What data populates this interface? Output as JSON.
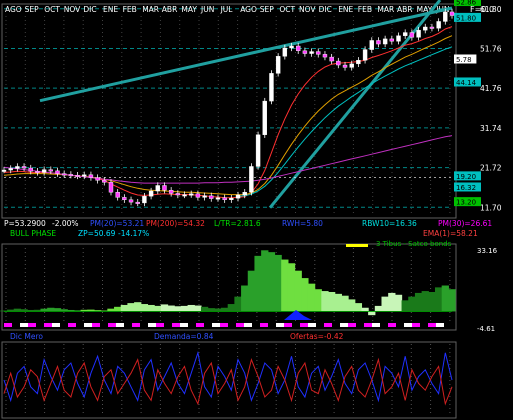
{
  "header": {
    "months": [
      "AGO",
      "SEP",
      "OCT",
      "NOV",
      "DIC",
      "ENE",
      "FEB",
      "MAR",
      "ABR",
      "MAY",
      "JUN",
      "JUL",
      "AGO",
      "SEP",
      "OCT",
      "NOV",
      "DIC",
      "ENE",
      "FEB",
      "MAR",
      "ABR",
      "MAY",
      "JUN"
    ],
    "f_label": "F=0.0"
  },
  "price_panel": {
    "axis_labels": [
      "61.80",
      "51.76",
      "41.76",
      "31.74",
      "21.72",
      "11.70"
    ],
    "level_tags": [
      {
        "text": "52.86",
        "color": "#00c000"
      },
      {
        "text": "51.80",
        "color": "#00c0c0"
      },
      {
        "text": "5.78",
        "color": "#ffffff"
      },
      {
        "text": "44.14",
        "color": "#00c0c0"
      },
      {
        "text": "19.20",
        "color": "#00c0c0"
      },
      {
        "text": "16.32",
        "color": "#00c0c0"
      },
      {
        "text": "13.20",
        "color": "#00c000"
      }
    ],
    "indicators_row1": [
      {
        "text": "P=53.2900",
        "color": "#ffffff"
      },
      {
        "text": "-2.00%",
        "color": "#ffffff"
      },
      {
        "text": "PM(20)=53.21",
        "color": "#3050ff"
      },
      {
        "text": "PM(200)=54.32",
        "color": "#ff3030"
      },
      {
        "text": "L/TR=2.81.6",
        "color": "#00e000"
      },
      {
        "text": "RWH=5.80",
        "color": "#3050ff"
      },
      {
        "text": "RBW10=16.36",
        "color": "#00e0e0"
      },
      {
        "text": "PM(30)=26.61",
        "color": "#ff00ff"
      }
    ],
    "indicators_row2": [
      {
        "text": "BULL PHASE",
        "color": "#00e000"
      },
      {
        "text": "ZP=50.69",
        "color": "#00e0ff"
      },
      {
        "text": "-14.17%",
        "color": "#00e0ff"
      },
      {
        "text": "EMA(1)=58.21",
        "color": "#ff4040"
      }
    ]
  },
  "oscillator_panel": {
    "title": "3 Tibus - Satco bonds",
    "max_label": "33.16",
    "min_label": "-4.61"
  },
  "bottom_panel": {
    "labels": [
      {
        "text": "Dic Mero",
        "color": "#3050ff"
      },
      {
        "text": "Demanda=0.84",
        "color": "#3050ff"
      },
      {
        "text": "Ofertas=-0.42",
        "color": "#ff3030"
      }
    ]
  },
  "chart_data": {
    "type": "line",
    "price_axis": [
      61.8,
      51.76,
      41.76,
      31.74,
      21.72,
      11.7
    ],
    "price_series": [
      {
        "name": "price",
        "color": "#ffffff",
        "values": [
          21.1,
          21.5,
          22.0,
          21.6,
          20.8,
          20.5,
          21.2,
          20.9,
          20.2,
          20.0,
          19.8,
          19.6,
          19.9,
          19.2,
          18.5,
          18.0,
          15.5,
          14.2,
          13.6,
          13.0,
          12.8,
          14.5,
          15.8,
          17.2,
          16.0,
          15.2,
          14.8,
          14.9,
          15.1,
          14.2,
          14.6,
          13.9,
          14.1,
          13.6,
          14.0,
          14.8,
          15.5,
          22.0,
          30.0,
          38.5,
          45.5,
          49.8,
          51.9,
          52.4,
          51.2,
          50.5,
          51.0,
          50.3,
          49.6,
          48.6,
          47.6,
          47.0,
          47.9,
          48.8,
          51.5,
          53.8,
          52.9,
          54.2,
          53.6,
          55.0,
          55.8,
          54.6,
          56.4,
          57.2,
          56.9,
          58.6,
          61.0,
          60.1
        ]
      },
      {
        "name": "pm20",
        "color": "#ff3030",
        "values": [
          20.5,
          20.6,
          20.8,
          20.7,
          20.5,
          20.4,
          20.5,
          20.4,
          20.2,
          20.0,
          19.8,
          19.6,
          19.5,
          19.3,
          18.9,
          18.5,
          17.6,
          16.8,
          16.0,
          15.3,
          14.8,
          14.7,
          14.8,
          15.0,
          15.1,
          15.0,
          14.9,
          14.9,
          14.9,
          14.7,
          14.6,
          14.4,
          14.3,
          14.1,
          14.1,
          14.2,
          14.4,
          15.4,
          17.6,
          21.0,
          25.5,
          30.0,
          34.0,
          37.5,
          40.3,
          42.6,
          44.5,
          46.0,
          47.1,
          47.8,
          48.1,
          48.2,
          48.3,
          48.5,
          48.8,
          49.5,
          50.0,
          50.6,
          51.2,
          51.9,
          52.6,
          53.0,
          53.6,
          54.3,
          54.8,
          55.6,
          56.7,
          57.3
        ]
      },
      {
        "name": "pm50",
        "color": "#e0a000",
        "values": [
          19.8,
          19.9,
          20.1,
          20.2,
          20.2,
          20.2,
          20.2,
          20.1,
          20.0,
          19.9,
          19.8,
          19.6,
          19.5,
          19.3,
          19.1,
          18.8,
          18.4,
          17.9,
          17.4,
          16.9,
          16.5,
          16.2,
          16.0,
          15.9,
          15.8,
          15.7,
          15.6,
          15.5,
          15.5,
          15.4,
          15.3,
          15.2,
          15.1,
          15.0,
          14.9,
          14.9,
          14.9,
          15.3,
          16.2,
          17.7,
          19.8,
          22.3,
          25.0,
          27.6,
          30.0,
          32.2,
          34.2,
          36.0,
          37.6,
          39.0,
          40.2,
          41.1,
          42.0,
          42.9,
          43.9,
          45.0,
          45.9,
          46.9,
          47.8,
          48.7,
          49.6,
          50.3,
          51.1,
          51.9,
          52.6,
          53.4,
          54.3,
          55.0
        ]
      },
      {
        "name": "pm200",
        "color": "#00c0c0",
        "values": [
          null,
          null,
          null,
          null,
          null,
          null,
          null,
          null,
          null,
          null,
          null,
          null,
          null,
          null,
          null,
          null,
          null,
          null,
          null,
          null,
          null,
          null,
          null,
          null,
          null,
          null,
          null,
          null,
          null,
          null,
          null,
          null,
          null,
          null,
          null,
          14.5,
          14.6,
          15.0,
          15.8,
          17.0,
          18.6,
          20.5,
          22.6,
          24.8,
          26.9,
          28.9,
          30.8,
          32.6,
          34.3,
          35.8,
          37.2,
          38.4,
          39.6,
          40.7,
          41.8,
          42.9,
          43.9,
          44.8,
          45.7,
          46.6,
          47.4,
          48.1,
          48.8,
          49.5,
          50.2,
          50.9,
          51.6,
          52.2
        ]
      },
      {
        "name": "pm30",
        "color": "#c030c0",
        "values": [
          21.8,
          21.6,
          21.4,
          21.2,
          21.0,
          20.8,
          20.6,
          20.4,
          20.2,
          20.0,
          19.8,
          19.6,
          19.4,
          19.2,
          19.0,
          18.8,
          18.6,
          18.4,
          18.2,
          18.0,
          17.9,
          17.8,
          17.8,
          17.8,
          17.8,
          17.8,
          17.8,
          17.8,
          17.8,
          17.8,
          17.9,
          17.9,
          17.9,
          18.0,
          18.0,
          18.1,
          18.2,
          18.3,
          18.5,
          18.8,
          19.1,
          19.5,
          19.9,
          20.3,
          20.7,
          21.1,
          21.5,
          21.9,
          22.3,
          22.7,
          23.1,
          23.5,
          23.9,
          24.3,
          24.7,
          25.1,
          25.5,
          25.9,
          26.3,
          26.7,
          27.1,
          27.5,
          27.9,
          28.3,
          28.7,
          29.1,
          29.5,
          29.8
        ]
      }
    ],
    "oscillator": {
      "ylim": [
        -4.61,
        33.16
      ],
      "values": [
        0.5,
        1.0,
        1.5,
        1.2,
        0.8,
        0.9,
        1.5,
        2.0,
        1.8,
        1.2,
        0.8,
        0.6,
        0.9,
        1.0,
        0.7,
        0.5,
        1.5,
        2.5,
        3.5,
        4.5,
        5.0,
        4.0,
        3.5,
        3.0,
        3.8,
        3.2,
        2.8,
        3.0,
        3.5,
        3.2,
        2.5,
        1.8,
        1.6,
        2.0,
        4.0,
        8.0,
        14.0,
        22.0,
        30.0,
        33.0,
        32.0,
        30.5,
        28.0,
        26.0,
        22.0,
        18.0,
        15.0,
        12.0,
        11.0,
        10.5,
        9.5,
        8.5,
        6.5,
        4.5,
        2.0,
        -2.0,
        3.0,
        8.0,
        10.0,
        9.0,
        6.0,
        8.0,
        10.0,
        11.0,
        10.5,
        13.0,
        14.0,
        12.0
      ]
    },
    "bottom": {
      "series": [
        {
          "name": "Demanda",
          "color": "#2030ff",
          "values": [
            50,
            20,
            60,
            70,
            40,
            30,
            80,
            55,
            35,
            65,
            75,
            45,
            25,
            60,
            85,
            50,
            30,
            70,
            60,
            40,
            20,
            65,
            80,
            35,
            55,
            75,
            45,
            30,
            60,
            90,
            40,
            25,
            70,
            55,
            35,
            80,
            60,
            20,
            45,
            75,
            65,
            30,
            50,
            85,
            40,
            25,
            60,
            70,
            35,
            55,
            80,
            45,
            30,
            65,
            75,
            50,
            20,
            70,
            60,
            40,
            85,
            35,
            55,
            65,
            45,
            30,
            90,
            50
          ]
        },
        {
          "name": "Ofertas",
          "color": "#d02020",
          "values": [
            30,
            60,
            25,
            40,
            65,
            55,
            20,
            45,
            70,
            35,
            25,
            60,
            75,
            40,
            20,
            55,
            65,
            30,
            45,
            60,
            80,
            35,
            20,
            65,
            45,
            30,
            55,
            70,
            35,
            15,
            60,
            75,
            30,
            45,
            65,
            20,
            40,
            80,
            55,
            25,
            35,
            70,
            50,
            20,
            60,
            75,
            35,
            30,
            65,
            45,
            20,
            55,
            70,
            35,
            25,
            50,
            80,
            30,
            40,
            60,
            20,
            65,
            45,
            35,
            55,
            70,
            15,
            40
          ]
        }
      ]
    }
  }
}
